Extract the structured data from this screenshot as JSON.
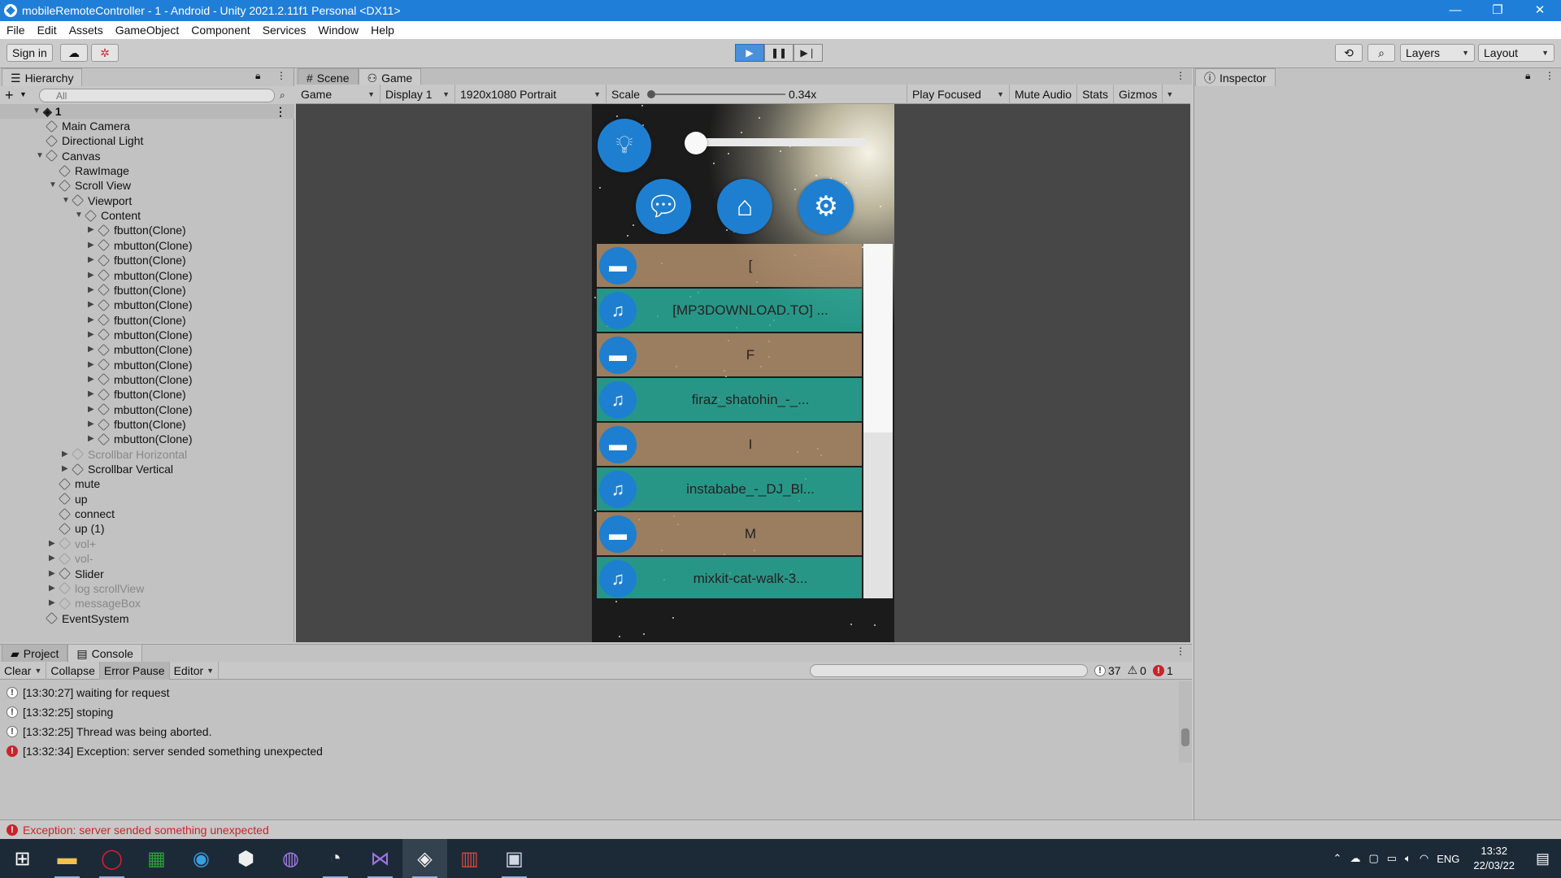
{
  "titlebar": {
    "title": "mobileRemoteController - 1 - Android - Unity 2021.2.11f1 Personal <DX11>",
    "min": "—",
    "max": "❐",
    "close": "✕"
  },
  "menu": [
    "File",
    "Edit",
    "Assets",
    "GameObject",
    "Component",
    "Services",
    "Window",
    "Help"
  ],
  "toolbar": {
    "signin": "Sign in",
    "layers": "Layers",
    "layout": "Layout"
  },
  "hierarchy": {
    "tab": "Hierarchy",
    "search_placeholder": "All",
    "scene": "1",
    "items": [
      {
        "label": "Main Camera",
        "indent": 1,
        "arrow": "",
        "dim": false
      },
      {
        "label": "Directional Light",
        "indent": 1,
        "arrow": "",
        "dim": false
      },
      {
        "label": "Canvas",
        "indent": 1,
        "arrow": "▼",
        "dim": false
      },
      {
        "label": "RawImage",
        "indent": 2,
        "arrow": "",
        "dim": false
      },
      {
        "label": "Scroll View",
        "indent": 2,
        "arrow": "▼",
        "dim": false
      },
      {
        "label": "Viewport",
        "indent": 3,
        "arrow": "▼",
        "dim": false
      },
      {
        "label": "Content",
        "indent": 4,
        "arrow": "▼",
        "dim": false
      },
      {
        "label": "fbutton(Clone)",
        "indent": 5,
        "arrow": "▶",
        "dim": false
      },
      {
        "label": "mbutton(Clone)",
        "indent": 5,
        "arrow": "▶",
        "dim": false
      },
      {
        "label": "fbutton(Clone)",
        "indent": 5,
        "arrow": "▶",
        "dim": false
      },
      {
        "label": "mbutton(Clone)",
        "indent": 5,
        "arrow": "▶",
        "dim": false
      },
      {
        "label": "fbutton(Clone)",
        "indent": 5,
        "arrow": "▶",
        "dim": false
      },
      {
        "label": "mbutton(Clone)",
        "indent": 5,
        "arrow": "▶",
        "dim": false
      },
      {
        "label": "fbutton(Clone)",
        "indent": 5,
        "arrow": "▶",
        "dim": false
      },
      {
        "label": "mbutton(Clone)",
        "indent": 5,
        "arrow": "▶",
        "dim": false
      },
      {
        "label": "mbutton(Clone)",
        "indent": 5,
        "arrow": "▶",
        "dim": false
      },
      {
        "label": "mbutton(Clone)",
        "indent": 5,
        "arrow": "▶",
        "dim": false
      },
      {
        "label": "mbutton(Clone)",
        "indent": 5,
        "arrow": "▶",
        "dim": false
      },
      {
        "label": "fbutton(Clone)",
        "indent": 5,
        "arrow": "▶",
        "dim": false
      },
      {
        "label": "mbutton(Clone)",
        "indent": 5,
        "arrow": "▶",
        "dim": false
      },
      {
        "label": "fbutton(Clone)",
        "indent": 5,
        "arrow": "▶",
        "dim": false
      },
      {
        "label": "mbutton(Clone)",
        "indent": 5,
        "arrow": "▶",
        "dim": false
      },
      {
        "label": "Scrollbar Horizontal",
        "indent": 3,
        "arrow": "▶",
        "dim": true
      },
      {
        "label": "Scrollbar Vertical",
        "indent": 3,
        "arrow": "▶",
        "dim": false
      },
      {
        "label": "mute",
        "indent": 2,
        "arrow": "",
        "dim": false
      },
      {
        "label": "up",
        "indent": 2,
        "arrow": "",
        "dim": false
      },
      {
        "label": "connect",
        "indent": 2,
        "arrow": "",
        "dim": false
      },
      {
        "label": "up (1)",
        "indent": 2,
        "arrow": "",
        "dim": false
      },
      {
        "label": "vol+",
        "indent": 2,
        "arrow": "▶",
        "dim": true
      },
      {
        "label": "vol-",
        "indent": 2,
        "arrow": "▶",
        "dim": true
      },
      {
        "label": "Slider",
        "indent": 2,
        "arrow": "▶",
        "dim": false
      },
      {
        "label": "log scrollView",
        "indent": 2,
        "arrow": "▶",
        "dim": true
      },
      {
        "label": "messageBox",
        "indent": 2,
        "arrow": "▶",
        "dim": true
      },
      {
        "label": "EventSystem",
        "indent": 1,
        "arrow": "",
        "dim": false
      }
    ]
  },
  "tabs": {
    "scene": "Scene",
    "game": "Game",
    "inspector": "Inspector",
    "project": "Project",
    "console": "Console"
  },
  "gamebar": {
    "game": "Game",
    "display": "Display 1",
    "resolution": "1920x1080 Portrait",
    "scale_label": "Scale",
    "scale_value": "0.34x",
    "play_focused": "Play Focused",
    "mute": "Mute Audio",
    "stats": "Stats",
    "gizmos": "Gizmos"
  },
  "phone": {
    "list": [
      {
        "type": "folder",
        "label": "["
      },
      {
        "type": "music",
        "label": "[MP3DOWNLOAD.TO] ..."
      },
      {
        "type": "folder",
        "label": "F"
      },
      {
        "type": "music",
        "label": "firaz_shatohin_-_..."
      },
      {
        "type": "folder",
        "label": "I"
      },
      {
        "type": "music",
        "label": "instababe_-_DJ_Bl..."
      },
      {
        "type": "folder",
        "label": "M"
      },
      {
        "type": "music",
        "label": "mixkit-cat-walk-3..."
      }
    ]
  },
  "console": {
    "clear": "Clear",
    "collapse": "Collapse",
    "error_pause": "Error Pause",
    "editor": "Editor",
    "count_info": "37",
    "count_warn": "0",
    "count_err": "1",
    "logs": [
      {
        "type": "info",
        "text": "[13:30:27] waiting for request"
      },
      {
        "type": "info",
        "text": "[13:32:25] stoping"
      },
      {
        "type": "info",
        "text": "[13:32:25] Thread was being aborted."
      },
      {
        "type": "err",
        "text": "[13:32:34] Exception: server sended something unexpected"
      }
    ]
  },
  "status": {
    "text": "Exception: server sended something unexpected"
  },
  "taskbar": {
    "lang": "ENG",
    "time": "13:32",
    "date": "22/03/22"
  }
}
